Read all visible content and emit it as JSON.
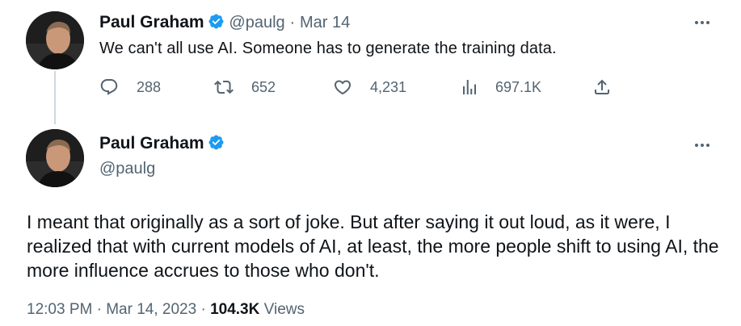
{
  "tweet1": {
    "author_name": "Paul Graham",
    "handle": "@paulg",
    "separator": "·",
    "date": "Mar 14",
    "text": "We can't all use AI. Someone has to generate the training data.",
    "replies": "288",
    "retweets": "652",
    "likes": "4,231",
    "views": "697.1K"
  },
  "tweet2": {
    "author_name": "Paul Graham",
    "handle": "@paulg",
    "text": "I meant that originally as a sort of joke. But after saying it out loud, as it were, I realized that with current models of AI, at least, the more people shift to using AI, the more influence accrues to those who don't.",
    "time": "12:03 PM",
    "separator": "·",
    "date": "Mar 14, 2023",
    "views_count": "104.3K",
    "views_label": "Views"
  },
  "icons": {
    "verified": "verified-badge-icon",
    "more": "more-dots-icon",
    "reply": "reply-icon",
    "retweet": "retweet-icon",
    "like": "like-icon",
    "views": "views-icon",
    "share": "share-icon"
  },
  "colors": {
    "verified": "#1d9bf0",
    "text": "#0f1419",
    "muted": "#536471",
    "thread_line": "#cfd9de"
  }
}
